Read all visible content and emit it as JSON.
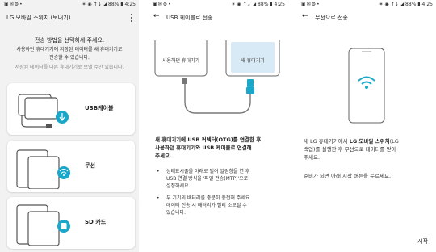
{
  "status": {
    "left_icons": "▣✉⚙•",
    "right": "✶ ◉ ↑↓ ◢ 88% ▮ 4:25"
  },
  "screen1": {
    "title": "LG 모바일 스위치 (보내기)",
    "question": "전송 방법을 선택하세 주세요.",
    "desc_line1": "사용하던 휴대기기에 저장된 데이터를 새 휴대기기로",
    "desc_line2": "전송할 수 있습니다.",
    "note": "저장된 데이터를 다른 휴대기기로 보낼 수만 있습니다.",
    "options": [
      {
        "label": "USB케이블"
      },
      {
        "label": "무선"
      },
      {
        "label": "SD 카드"
      }
    ]
  },
  "screen2": {
    "title": "USB 케이블로 전송",
    "old_device": "사용하던 휴대기기",
    "new_device": "새 휴대기기",
    "instruction": [
      "새 휴대기기에 USB 커넥터(OTG)를 연결한 후",
      "사용하던 휴대기기와 USB 케이블로 연결해",
      "주세요."
    ],
    "bullet1": [
      "상태표시줄을 아래로 밀어 알림창을 연 후",
      "USB 연결 방식을 '파일 전송(MTP)'으로",
      "설정하세요."
    ],
    "bullet2": [
      "두 기기의 배터리를 충분히 충전해 주세요.",
      "데이터 전송 시 배터리가 빨리 소모될 수",
      "있습니다."
    ]
  },
  "screen3": {
    "title": "무선으로 전송",
    "line1_a": "새 LG 휴대기기에서 ",
    "line1_b": "LG 모바일 스위치",
    "line1_c": "(LG",
    "line2_a": "백업)",
    "line2_b": "를 실행한 후 무선으로 데이터를 받아",
    "line3": "주세요.",
    "sub": "준비가 되면 아래 시작 버튼을 누르세요.",
    "start": "시작"
  },
  "colors": {
    "accent": "#1aa7c9",
    "background_list": "#f2f2f2"
  }
}
